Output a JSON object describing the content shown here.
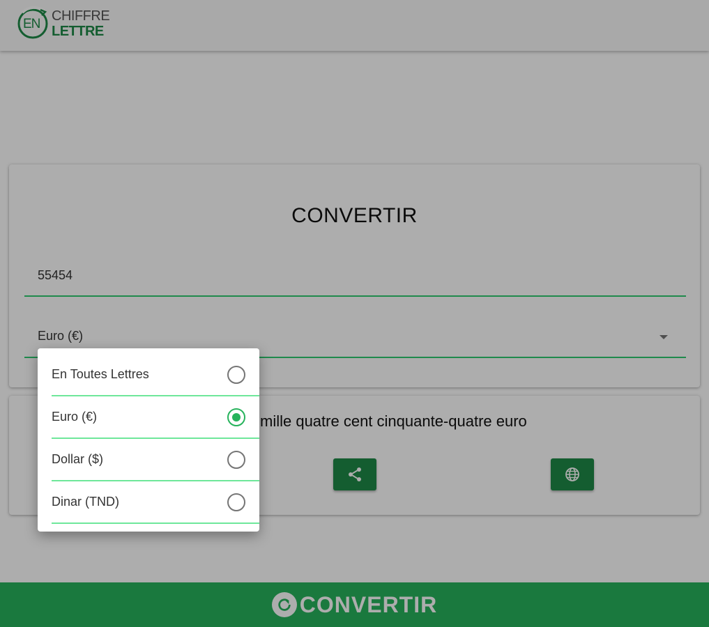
{
  "header": {
    "logo_badge": "EN",
    "logo_line1": "CHIFFRE",
    "logo_line2": "LETTRE"
  },
  "converter": {
    "title": "CONVERTIR",
    "number_value": "55454",
    "selected_currency": "Euro (€)"
  },
  "result": {
    "text": "mille quatre cent cinquante-quatre euro",
    "share_icon": "share-icon",
    "web_icon": "globe-icon"
  },
  "dropdown": {
    "options": [
      {
        "label": "En Toutes Lettres",
        "selected": false
      },
      {
        "label": "Euro (€)",
        "selected": true
      },
      {
        "label": "Dollar ($)",
        "selected": false
      },
      {
        "label": "Dinar (TND)",
        "selected": false
      }
    ]
  },
  "footer": {
    "button_label": "CONVERTIR",
    "button_icon": "refresh-icon"
  },
  "colors": {
    "brand_green": "#1e8a47",
    "accent_green": "#27b35c",
    "underline_green": "#2ecc71"
  }
}
